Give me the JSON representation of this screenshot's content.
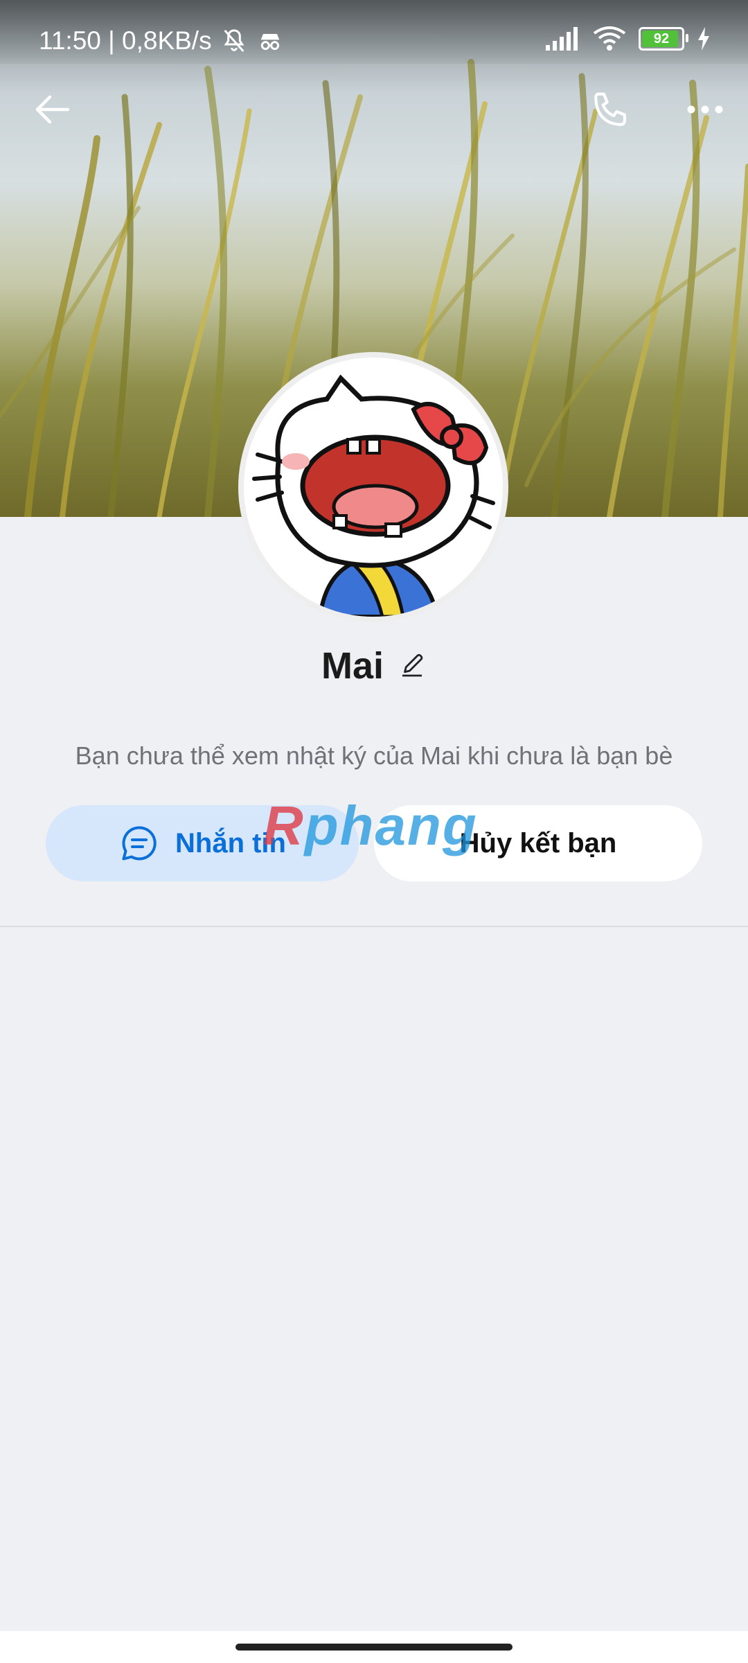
{
  "status_bar": {
    "time_speed": "11:50 | 0,8KB/s",
    "battery_level": "92",
    "icons": [
      "muted-bell-icon",
      "incognito-icon",
      "signal-icon",
      "wifi-icon",
      "battery-icon",
      "charging-icon"
    ]
  },
  "header": {
    "back_icon": "arrow-left-icon",
    "call_icon": "phone-icon",
    "more_icon": "more-dots-icon"
  },
  "profile": {
    "name": "Mai",
    "edit_icon": "pencil-icon",
    "info_text": "Bạn chưa thể xem nhật ký của Mai khi chưa là bạn bè"
  },
  "actions": {
    "message_label": "Nhắn tin",
    "unfriend_label": "Hủy kết bạn"
  },
  "watermark": {
    "part1": "R",
    "part2": "phang"
  },
  "colors": {
    "accent": "#0a6fd8",
    "message_button_bg": "#d6e7fb",
    "page_bg": "#eff0f4"
  }
}
